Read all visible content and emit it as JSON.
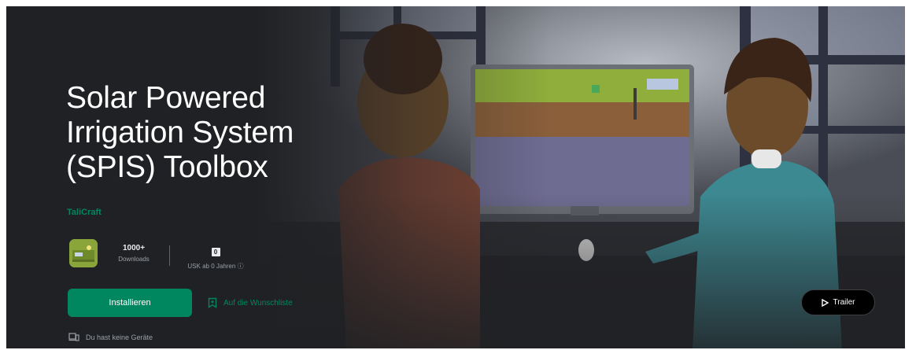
{
  "app": {
    "title_lines": [
      "Solar Powered",
      "Irrigation System",
      "(SPIS) Toolbox"
    ],
    "developer": "TaliCraft",
    "icon": "app-icon-solar-field"
  },
  "stats": {
    "downloads_value": "1000+",
    "downloads_label": "Downloads",
    "rating_badge": "0",
    "rating_label": "USK ab 0 Jahren"
  },
  "actions": {
    "install_label": "Installieren",
    "wishlist_label": "Auf die Wunschliste",
    "trailer_label": "Trailer"
  },
  "devices_note": "Du hast keine Geräte",
  "colors": {
    "accent": "#01875f",
    "background": "#202124",
    "text": "#ffffff"
  }
}
